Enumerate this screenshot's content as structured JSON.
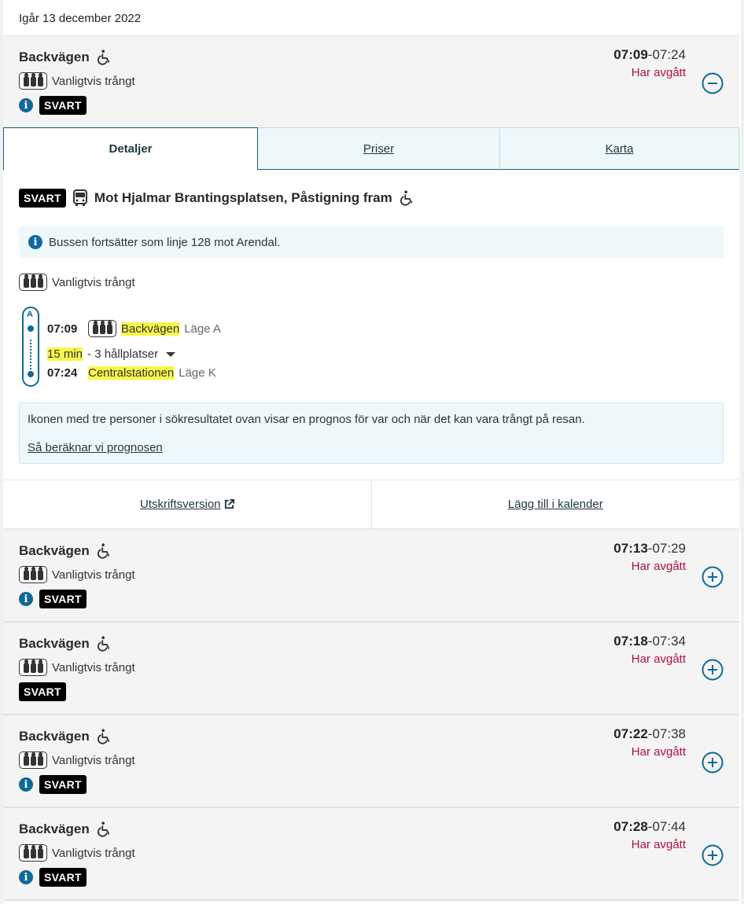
{
  "date_header": "Igår 13 december 2022",
  "expanded_trip": {
    "stop": "Backvägen",
    "crowd_text": "Vanligtvis trångt",
    "line": "SVART",
    "dep": "07:09",
    "arr": "07:24",
    "status": "Har avgått"
  },
  "details": {
    "tabs": [
      "Detaljer",
      "Priser",
      "Karta"
    ],
    "line": "SVART",
    "direction": "Mot Hjalmar Brantingsplatsen, Påstigning fram",
    "notice": "Bussen fortsätter som linje 128 mot Arendal.",
    "crowd_text": "Vanligtvis trångt",
    "stops": [
      {
        "letter": "A",
        "time": "07:09",
        "name": "Backvägen",
        "pos": "Läge A"
      },
      {
        "time": "07:24",
        "name": "Centralstationen",
        "pos": "Läge K"
      }
    ],
    "duration": "15 min",
    "duration_rest": "- 3 hållplatser",
    "prognosis_text": "Ikonen med tre personer i sökresultatet ovan visar en prognos för var och när det kan vara trångt på resan.",
    "prognosis_link": "Så beräknar vi prognosen",
    "print_link": "Utskriftsversion",
    "calendar_link": "Lägg till i kalender"
  },
  "trips": [
    {
      "stop": "Backvägen",
      "crowd_text": "Vanligtvis trångt",
      "line": "SVART",
      "has_info": true,
      "dep": "07:13",
      "arr": "07:29",
      "status": "Har avgått"
    },
    {
      "stop": "Backvägen",
      "crowd_text": "Vanligtvis trångt",
      "line": "SVART",
      "has_info": false,
      "dep": "07:18",
      "arr": "07:34",
      "status": "Har avgått"
    },
    {
      "stop": "Backvägen",
      "crowd_text": "Vanligtvis trångt",
      "line": "SVART",
      "has_info": true,
      "dep": "07:22",
      "arr": "07:38",
      "status": "Har avgått"
    },
    {
      "stop": "Backvägen",
      "crowd_text": "Vanligtvis trångt",
      "line": "SVART",
      "has_info": true,
      "dep": "07:28",
      "arr": "07:44",
      "status": "Har avgått"
    }
  ],
  "colors": {
    "accent": "#0f6a98",
    "status": "#b3123b",
    "highlight": "#f7f74a"
  },
  "icons": {
    "wheelchair": "wheelchair-icon",
    "bus": "bus-icon",
    "crowd": "crowd-icon",
    "info": "info-icon",
    "expand": "plus-circle-icon",
    "collapse": "minus-circle-icon",
    "external": "external-link-icon"
  }
}
